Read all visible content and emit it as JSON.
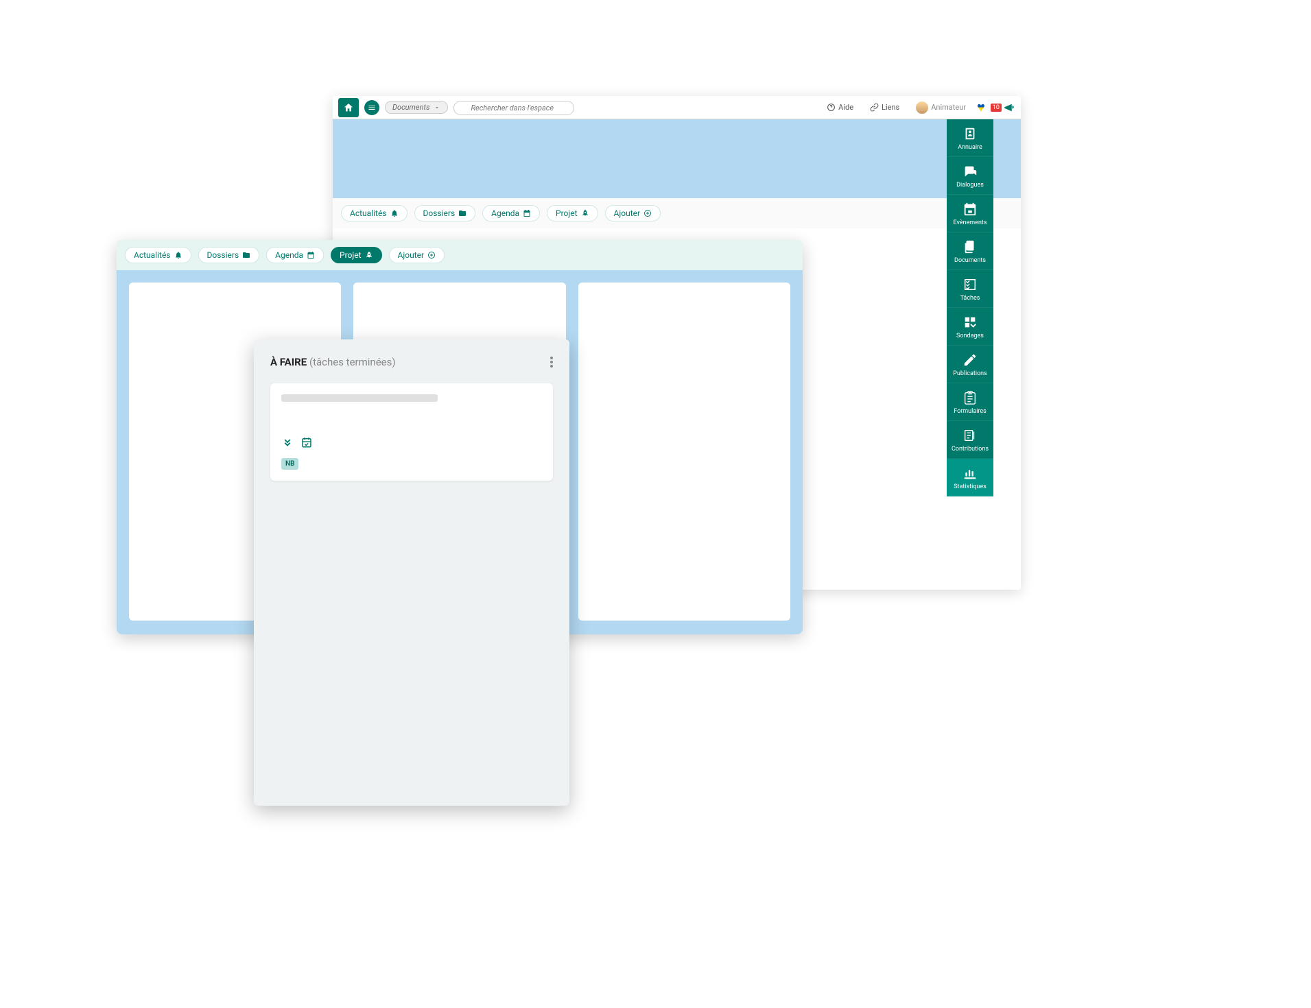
{
  "topbar": {
    "search_dropdown": "Documents",
    "search_placeholder": "Rechercher dans l'espace",
    "help_label": "Aide",
    "links_label": "Liens",
    "user_role": "Animateur",
    "notif_count": "10"
  },
  "tabs_back": [
    {
      "label": "Actualités",
      "icon": "bell"
    },
    {
      "label": "Dossiers",
      "icon": "folder"
    },
    {
      "label": "Agenda",
      "icon": "calendar"
    },
    {
      "label": "Projet",
      "icon": "rocket"
    },
    {
      "label": "Ajouter",
      "icon": "plus"
    }
  ],
  "tabs_mid": [
    {
      "label": "Actualités",
      "icon": "bell",
      "active": false
    },
    {
      "label": "Dossiers",
      "icon": "folder",
      "active": false
    },
    {
      "label": "Agenda",
      "icon": "calendar",
      "active": false
    },
    {
      "label": "Projet",
      "icon": "rocket",
      "active": true
    },
    {
      "label": "Ajouter",
      "icon": "plus",
      "active": false
    }
  ],
  "sidebar": [
    {
      "label": "Annuaire",
      "icon": "contacts"
    },
    {
      "label": "Dialogues",
      "icon": "chat"
    },
    {
      "label": "Evènements",
      "icon": "event"
    },
    {
      "label": "Documents",
      "icon": "docs"
    },
    {
      "label": "Tâches",
      "icon": "checklist"
    },
    {
      "label": "Sondages",
      "icon": "apps"
    },
    {
      "label": "Publications",
      "icon": "pencil"
    },
    {
      "label": "Formulaires",
      "icon": "clipboard"
    },
    {
      "label": "Contributions",
      "icon": "notes"
    },
    {
      "label": "Statistiques",
      "icon": "chart",
      "active": true
    }
  ],
  "front_panel": {
    "title_bold": "À FAIRE",
    "title_sub": "(tâches terminées)",
    "task_badge": "NB"
  }
}
